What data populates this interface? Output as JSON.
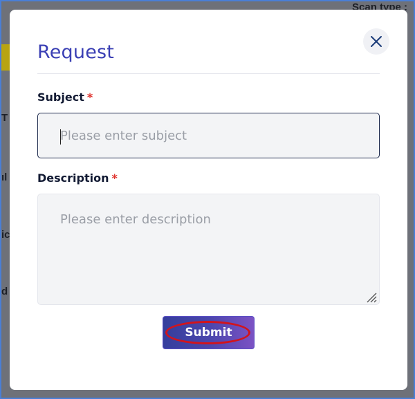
{
  "background": {
    "scan_type_fragment": "Scan type :",
    "left_fragments": [
      "T",
      "ıl",
      "ic",
      "d"
    ]
  },
  "modal": {
    "title": "Request",
    "close_icon": "close-icon",
    "subject": {
      "label": "Subject",
      "required_mark": "*",
      "placeholder": "Please enter subject",
      "value": ""
    },
    "description": {
      "label": "Description",
      "required_mark": "*",
      "placeholder": "Please enter description",
      "value": ""
    },
    "submit_label": "Submit"
  },
  "colors": {
    "title": "#3a3fb4",
    "required": "#e0342f",
    "submit_gradient_start": "#353e9c",
    "submit_gradient_end": "#7b52c4",
    "highlight_ring": "#d2141c"
  }
}
